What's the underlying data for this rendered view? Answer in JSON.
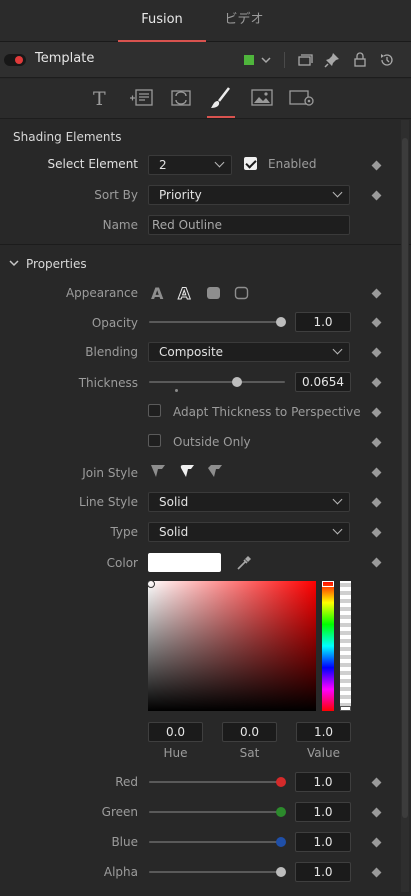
{
  "tabs": [
    {
      "label": "Fusion"
    },
    {
      "label": "ビデオ"
    }
  ],
  "node": {
    "title": "Template",
    "color": "#4fb53c"
  },
  "shading": {
    "section_title": "Shading Elements",
    "select_element": {
      "label": "Select Element",
      "value": "2"
    },
    "enabled": {
      "label": "Enabled",
      "checked": true
    },
    "sort_by": {
      "label": "Sort By",
      "value": "Priority"
    },
    "name": {
      "label": "Name",
      "value": "Red Outline"
    }
  },
  "properties": {
    "section_title": "Properties",
    "appearance_label": "Appearance",
    "opacity": {
      "label": "Opacity",
      "value": "1.0",
      "level": 1.0
    },
    "blending": {
      "label": "Blending",
      "value": "Composite"
    },
    "thickness": {
      "label": "Thickness",
      "value": "0.0654",
      "level": 0.65
    },
    "adapt_thickness": {
      "label": "Adapt Thickness to Perspective",
      "checked": false
    },
    "outside_only": {
      "label": "Outside Only",
      "checked": false
    },
    "join_style_label": "Join Style",
    "line_style": {
      "label": "Line Style",
      "value": "Solid"
    },
    "type": {
      "label": "Type",
      "value": "Solid"
    },
    "color": {
      "label": "Color",
      "swatch": "#ffffff"
    },
    "hsv": {
      "hue": {
        "value": "0.0",
        "caption": "Hue"
      },
      "sat": {
        "value": "0.0",
        "caption": "Sat"
      },
      "val": {
        "value": "1.0",
        "caption": "Value"
      }
    },
    "channels": [
      {
        "label": "Red",
        "value": "1.0",
        "knob_color": "#d42a2a"
      },
      {
        "label": "Green",
        "value": "1.0",
        "knob_color": "#2c8a2c"
      },
      {
        "label": "Blue",
        "value": "1.0",
        "knob_color": "#1f4fa8"
      },
      {
        "label": "Alpha",
        "value": "1.0",
        "knob_color": "#bdbdbd"
      }
    ]
  }
}
